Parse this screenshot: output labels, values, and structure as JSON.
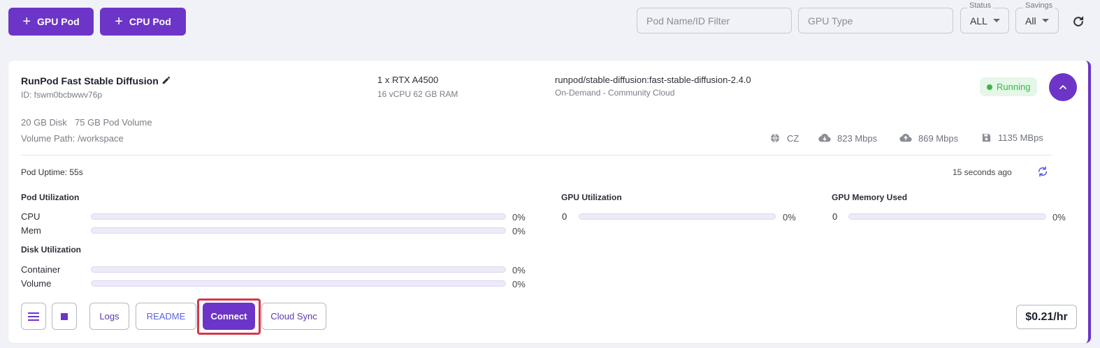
{
  "toolbar": {
    "gpu_pod_label": "GPU Pod",
    "cpu_pod_label": "CPU Pod",
    "pod_filter_placeholder": "Pod Name/ID Filter",
    "gpu_type_placeholder": "GPU Type",
    "status_label": "Status",
    "status_value": "ALL",
    "savings_label": "Savings",
    "savings_value": "All"
  },
  "pod": {
    "name": "RunPod Fast Stable Diffusion",
    "id": "ID: fswm0bcbwwv76p",
    "gpu": "1 x RTX A4500",
    "specs": "16 vCPU 62 GB RAM",
    "image": "runpod/stable-diffusion:fast-stable-diffusion-2.4.0",
    "plan": "On-Demand - Community Cloud",
    "status": "Running",
    "disk": "20 GB Disk",
    "volume": "75 GB Pod Volume",
    "volume_path": "Volume Path: /workspace",
    "location": "CZ",
    "download": "823 Mbps",
    "upload": "869 Mbps",
    "disk_speed": "1135 MBps",
    "uptime": "Pod Uptime: 55s",
    "updated": "15 seconds ago"
  },
  "utilization": {
    "pod_title": "Pod Utilization",
    "cpu_label": "CPU",
    "cpu_pct": "0%",
    "cpu_fraction": 0,
    "mem_label": "Mem",
    "mem_pct": "0%",
    "mem_fraction": 0,
    "disk_title": "Disk Utilization",
    "container_label": "Container",
    "container_pct": "0%",
    "container_fraction": 0,
    "volume_label": "Volume",
    "volume_pct": "0%",
    "volume_fraction": 0,
    "gpu_title": "GPU Utilization",
    "gpu_index": "0",
    "gpu_pct": "0%",
    "gpu_fraction": 0,
    "gpu_mem_title": "GPU Memory Used",
    "gpu_mem_index": "0",
    "gpu_mem_pct": "0%",
    "gpu_mem_fraction": 0
  },
  "actions": {
    "logs": "Logs",
    "readme": "README",
    "connect": "Connect",
    "cloud_sync": "Cloud Sync",
    "price": "$0.21/hr"
  },
  "colors": {
    "accent": "#6c35c7",
    "running": "#3bb54a",
    "highlight": "#d6364a"
  }
}
